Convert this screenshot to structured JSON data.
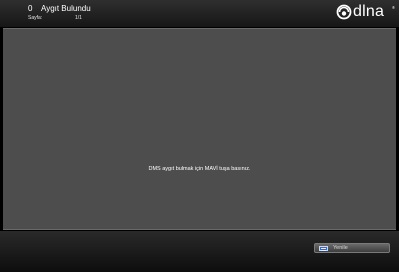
{
  "header": {
    "device_count": "0",
    "device_label": "Aygıt Bulundu",
    "page_label": "Sayfa:",
    "page_value": "1/1",
    "logo_text": "dlna",
    "logo_tm": "®",
    "logo_icon": "dlna-logo-icon"
  },
  "main": {
    "message": "DMS aygıt bulmak için MAVİ tuşa basınız."
  },
  "footer": {
    "refresh_label": "Yenile",
    "refresh_icon": "blue-key-icon",
    "refresh_icon_color": "#2e6bd6"
  },
  "colors": {
    "panel_background": "#4d4d4d",
    "bar_background": "#1a1a1a"
  }
}
